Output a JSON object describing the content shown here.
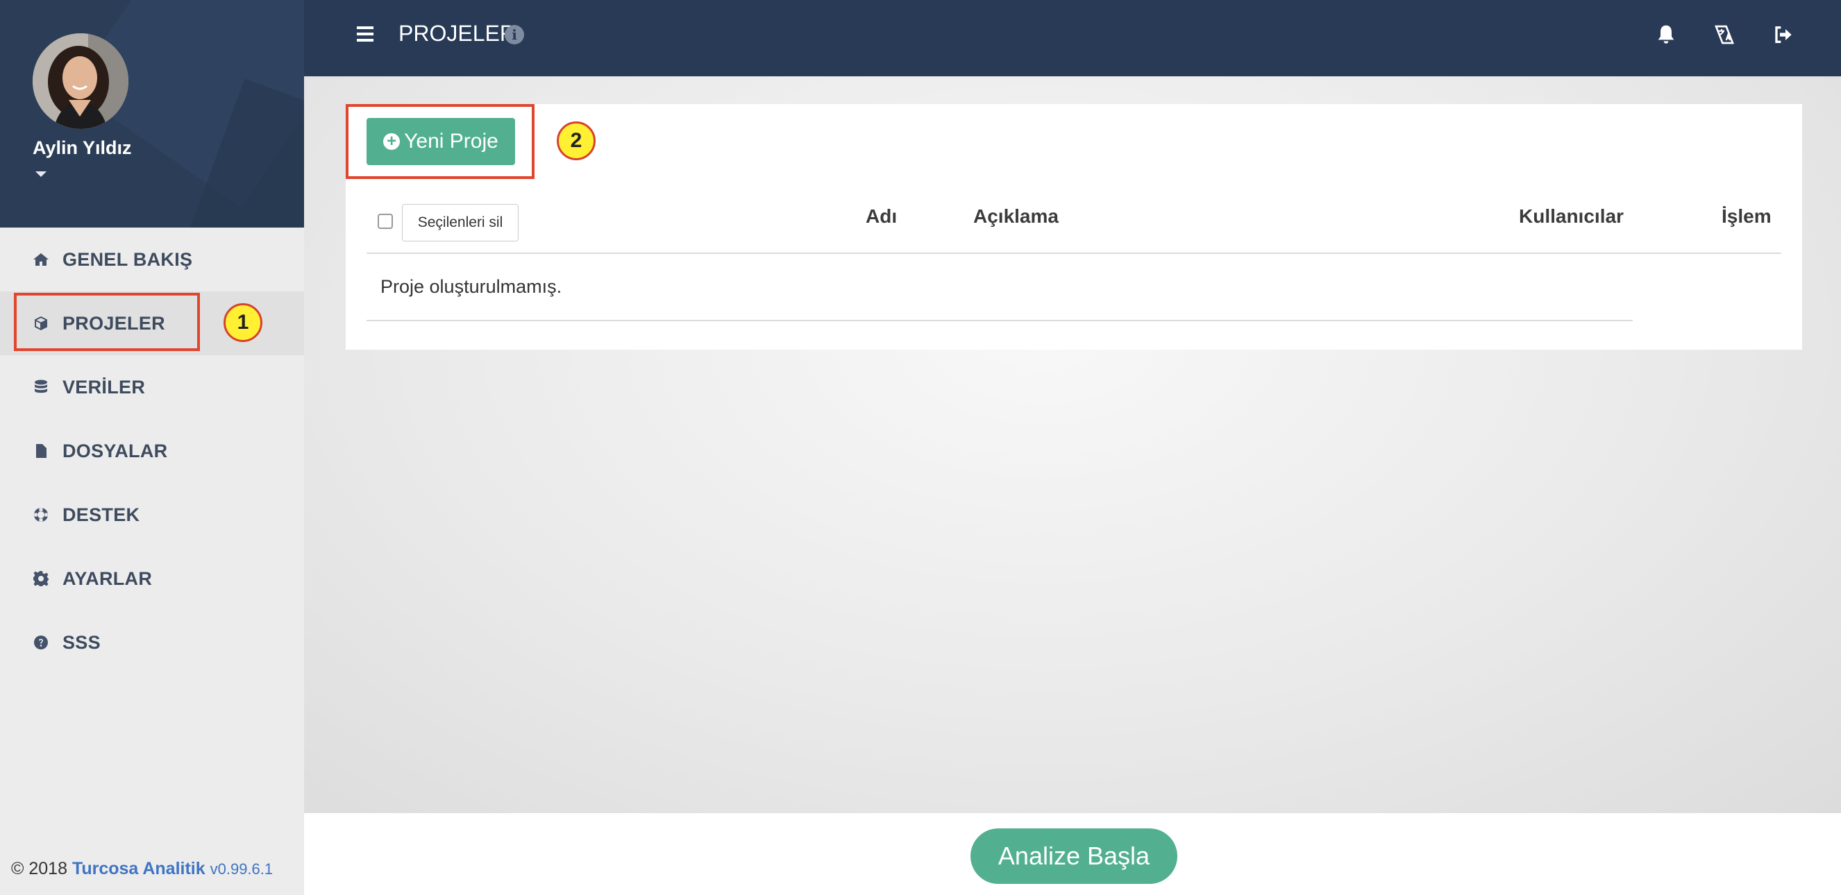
{
  "sidebar": {
    "user_name": "Aylin Yıldız",
    "items": [
      {
        "label": "GENEL BAKIŞ",
        "icon": "home-icon"
      },
      {
        "label": "PROJELER",
        "icon": "cube-icon"
      },
      {
        "label": "VERİLER",
        "icon": "database-icon"
      },
      {
        "label": "DOSYALAR",
        "icon": "file-icon"
      },
      {
        "label": "DESTEK",
        "icon": "life-ring-icon"
      },
      {
        "label": "AYARLAR",
        "icon": "gear-icon"
      },
      {
        "label": "SSS",
        "icon": "question-circle-icon"
      }
    ],
    "footer": {
      "copyright": "© 2018",
      "brand": "Turcosa Analitik",
      "version": "v0.99.6.1"
    }
  },
  "header": {
    "title": "PROJELER",
    "icons": [
      "menu-icon",
      "info-icon",
      "bell-icon",
      "translate-icon",
      "logout-icon"
    ]
  },
  "main": {
    "new_project_button": "Yeni Proje",
    "delete_selected_button": "Seçilenleri sil",
    "table": {
      "columns": [
        "Adı",
        "Açıklama",
        "Kullanıcılar",
        "İşlem"
      ],
      "empty_message": "Proje oluşturulmamış."
    },
    "analyze_button": "Analize Başla"
  },
  "annotations": [
    {
      "number": "1",
      "target": "PROJELER"
    },
    {
      "number": "2",
      "target": "Yeni Proje"
    }
  ],
  "colors": {
    "header_bg": "#283a55",
    "accent_green": "#52b090",
    "annotation_red": "#e1452e",
    "badge_yellow": "#fff033",
    "link_blue": "#3f74c4"
  }
}
